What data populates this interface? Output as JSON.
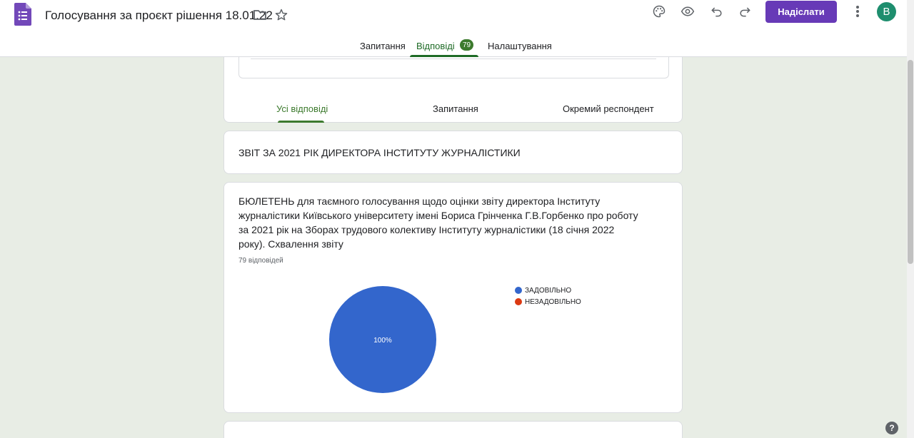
{
  "header": {
    "title": "Голосування за проєкт рішення 18.01.22",
    "send_label": "Надіслати",
    "avatar_letter": "В",
    "brand_color": "#673ab7"
  },
  "main_tabs": [
    {
      "label": "Запитання"
    },
    {
      "label": "Відповіді",
      "badge": "79"
    },
    {
      "label": "Налаштування"
    }
  ],
  "sub_tabs": [
    {
      "label": "Усі відповіді"
    },
    {
      "label": "Запитання"
    },
    {
      "label": "Окремий респондент"
    }
  ],
  "section": {
    "title": "ЗВІТ ЗА 2021 РІК ДИРЕКТОРА ІНСТИТУТУ ЖУРНАЛІСТИКИ"
  },
  "question": {
    "text": "БЮЛЕТЕНЬ для таємного голосування щодо оцінки звіту директора Інституту журналістики Київського університету імені Бориса Грінченка Г.В.Горбенко про роботу за 2021 рік на Зборах трудового колективу Інституту журналістики (18 січня 2022 року). Схвалення звіту",
    "responses": "79 відповідей"
  },
  "chart_data": {
    "type": "pie",
    "categories": [
      "ЗАДОВІЛЬНО",
      "НЕЗАДОВІЛЬНО"
    ],
    "values": [
      100,
      0
    ],
    "data_labels": [
      "100%",
      ""
    ],
    "colors": [
      "#3366cc",
      "#dc3912"
    ],
    "legend": "right"
  }
}
